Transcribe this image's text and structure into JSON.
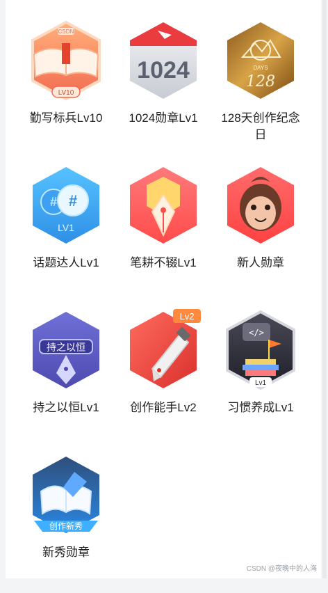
{
  "badges": [
    {
      "label": "勤写标兵Lv10",
      "icon": "open-book-icon",
      "color": "#f26a4f",
      "level": "LV10"
    },
    {
      "label": "1024勋章Lv1",
      "icon": "calendar-1024-icon",
      "color": "#7a7f8a",
      "text": "1024"
    },
    {
      "label": "128天创作纪念日",
      "icon": "days-128-icon",
      "color": "#c79131",
      "text": "128"
    },
    {
      "label": "话题达人Lv1",
      "icon": "hashtag-chat-icon",
      "color": "#2f8fe6",
      "level": "LV1"
    },
    {
      "label": "笔耕不辍Lv1",
      "icon": "pen-nib-icon",
      "color": "#ff4b4b"
    },
    {
      "label": "新人勋章",
      "icon": "monkey-face-icon",
      "color": "#ff5a5a"
    },
    {
      "label": "持之以恒Lv1",
      "icon": "persistence-icon",
      "color": "#5b57b8",
      "text": "持之以恒"
    },
    {
      "label": "创作能手Lv2",
      "icon": "fountain-pen-icon",
      "color": "#f0473a",
      "tag": "Lv2"
    },
    {
      "label": "习惯养成Lv1",
      "icon": "code-books-icon",
      "color": "#2f2f3a",
      "level": "Lv1"
    },
    {
      "label": "新秀勋章",
      "icon": "new-talent-icon",
      "color": "#2a88e6",
      "text": "创作新秀"
    }
  ],
  "watermark": "CSDN @夜晚中的人海"
}
